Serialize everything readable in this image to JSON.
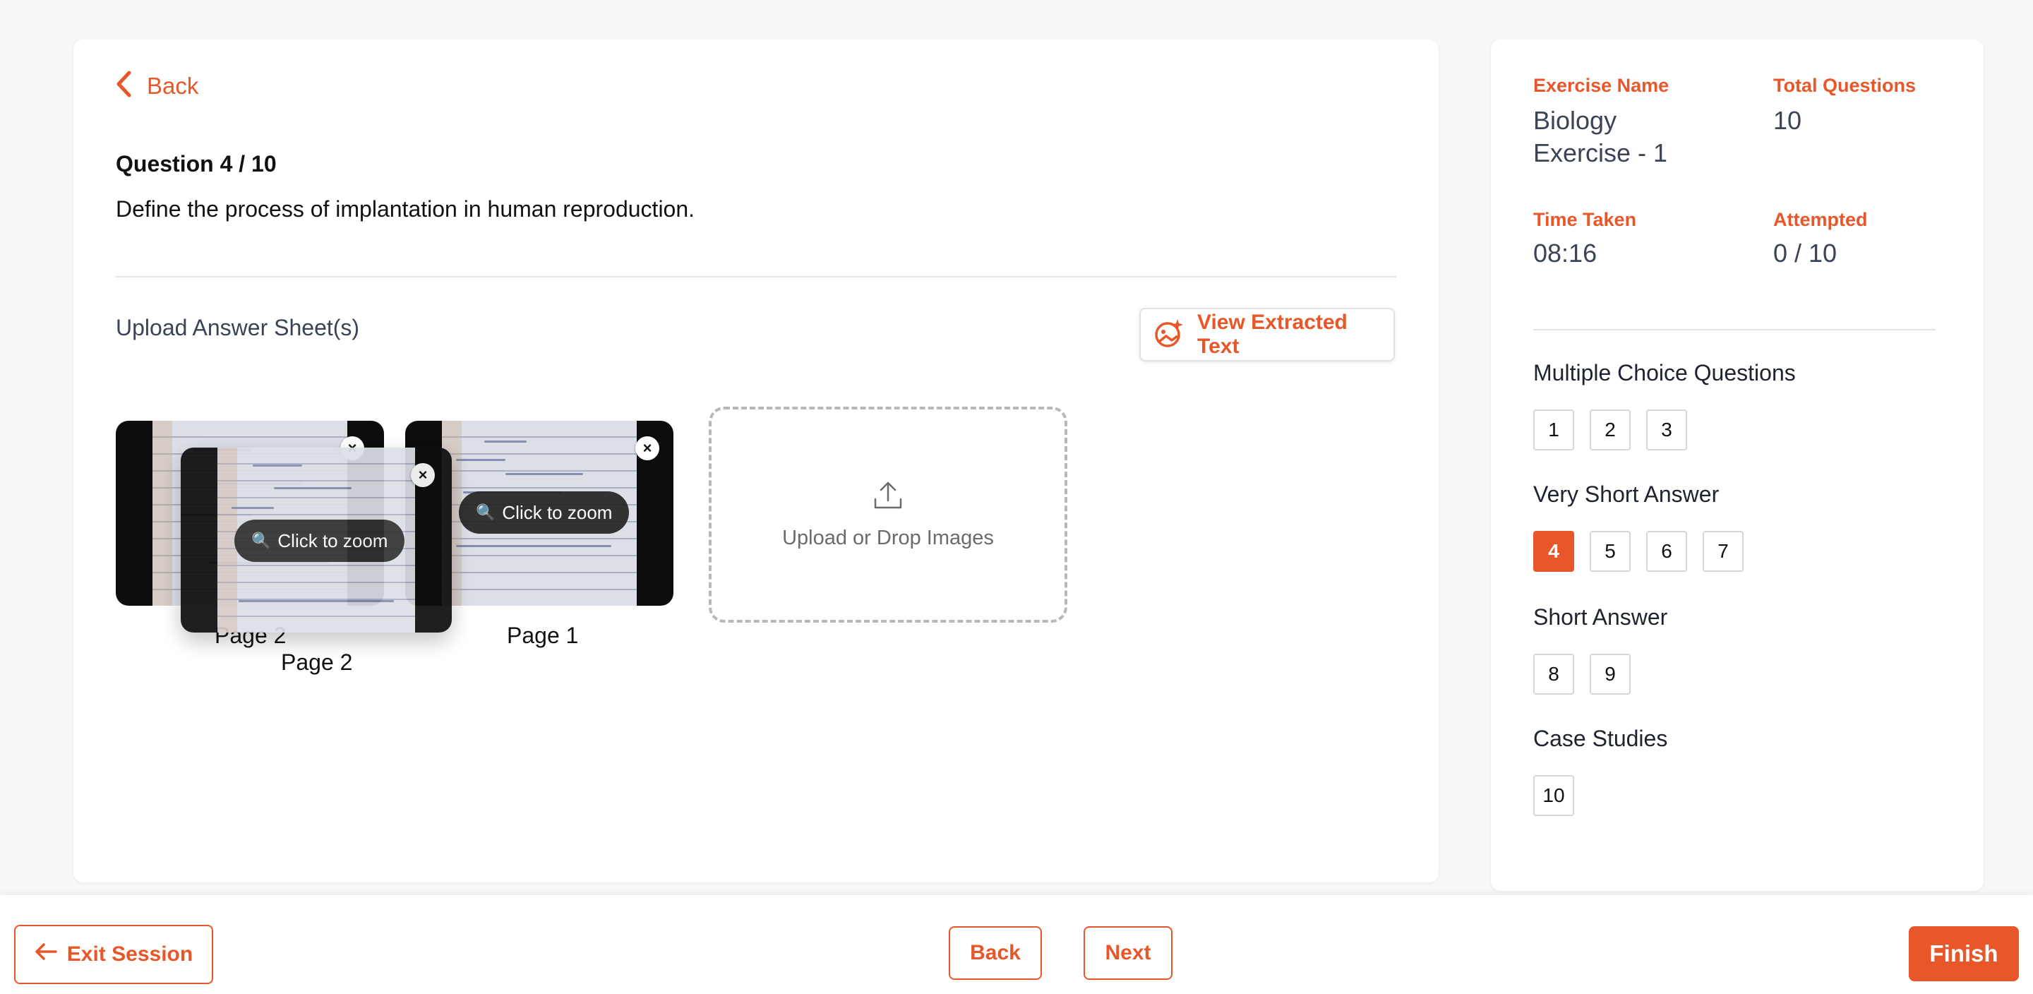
{
  "main": {
    "back_label": "Back",
    "question_title": "Question 4 / 10",
    "question_text": "Define the process of implantation in human reproduction.",
    "upload_label": "Upload Answer Sheet(s)",
    "view_extracted_label": "View Extracted Text",
    "thumbnails": [
      {
        "zoom_label": "Click to zoom",
        "page_label": "Page 2",
        "close_icon": "close-icon"
      },
      {
        "zoom_label": "Click to zoom",
        "page_label": "Page 1",
        "close_icon": "close-icon"
      },
      {
        "zoom_label": "Click to zoom",
        "page_label": "Page 2",
        "close_icon": "close-icon"
      }
    ],
    "dropzone_label": "Upload or Drop Images"
  },
  "sidebar": {
    "exercise_name_label": "Exercise Name",
    "exercise_name_value": "Biology Exercise - 1",
    "total_questions_label": "Total Questions",
    "total_questions_value": "10",
    "time_taken_label": "Time Taken",
    "time_taken_value": "08:16",
    "attempted_label": "Attempted",
    "attempted_value": "0 / 10",
    "sections": [
      {
        "title": "Multiple Choice Questions",
        "questions": [
          "1",
          "2",
          "3"
        ]
      },
      {
        "title": "Very Short Answer",
        "questions": [
          "4",
          "5",
          "6",
          "7"
        ]
      },
      {
        "title": "Short Answer",
        "questions": [
          "8",
          "9"
        ]
      },
      {
        "title": "Case Studies",
        "questions": [
          "10"
        ]
      }
    ],
    "active_question": "4"
  },
  "footer": {
    "exit_label": "Exit Session",
    "back_label": "Back",
    "next_label": "Next",
    "finish_label": "Finish"
  },
  "colors": {
    "accent": "#e8572a",
    "text_muted": "#3b4356"
  }
}
